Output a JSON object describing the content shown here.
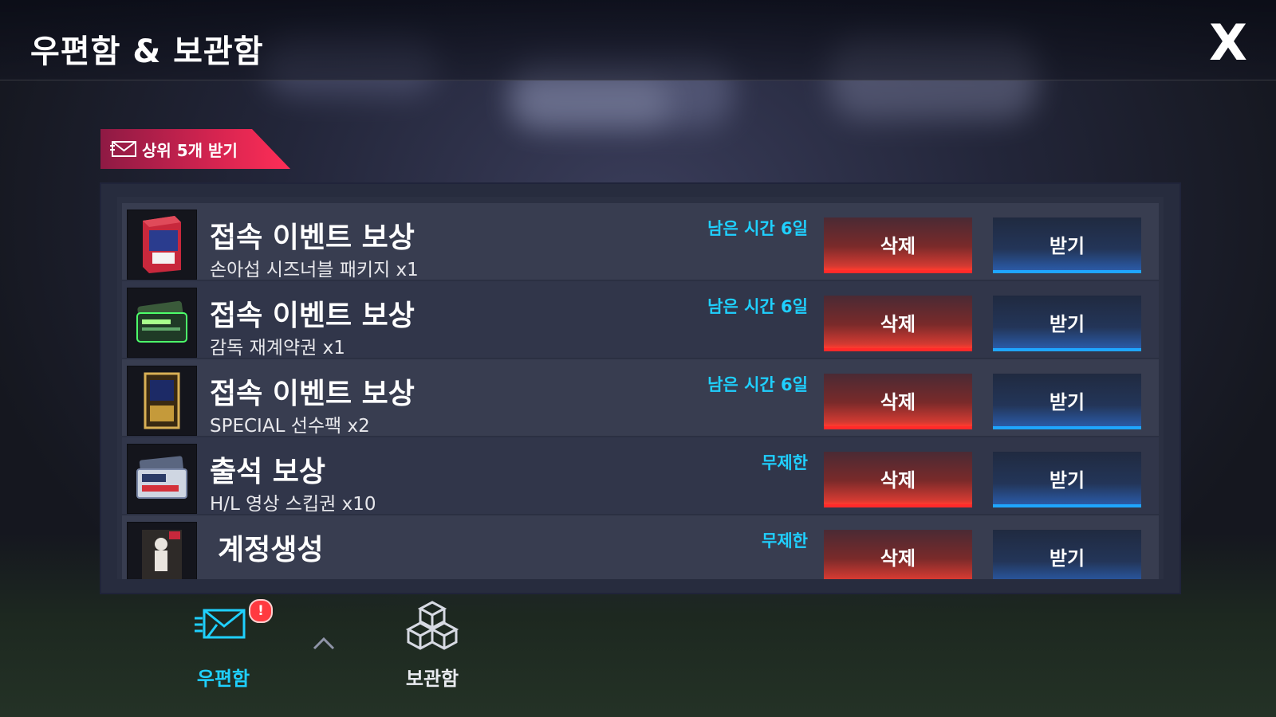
{
  "header": {
    "title": "우편함 & 보관함",
    "close_label": "X"
  },
  "claim_top": {
    "label": "상위 5개 받기"
  },
  "items": [
    {
      "title": "접속 이벤트 보상",
      "subtitle": "손아섭 시즈너블 패키지 x1",
      "remaining": "남은 시간 6일",
      "delete_label": "삭제",
      "claim_label": "받기",
      "thumb_icon": "package-icon"
    },
    {
      "title": "접속 이벤트 보상",
      "subtitle": "감독 재계약권 x1",
      "remaining": "남은 시간 6일",
      "delete_label": "삭제",
      "claim_label": "받기",
      "thumb_icon": "ticket-icon"
    },
    {
      "title": "접속 이벤트 보상",
      "subtitle": "SPECIAL 선수팩 x2",
      "remaining": "남은 시간 6일",
      "delete_label": "삭제",
      "claim_label": "받기",
      "thumb_icon": "card-pack-icon"
    },
    {
      "title": "출석 보상",
      "subtitle": "H/L 영상 스킵권 x10",
      "remaining": "무제한",
      "delete_label": "삭제",
      "claim_label": "받기",
      "thumb_icon": "skip-ticket-icon"
    },
    {
      "title": "계정생성",
      "subtitle": "",
      "remaining": "무제한",
      "delete_label": "삭제",
      "claim_label": "받기",
      "thumb_icon": "player-card-icon"
    }
  ],
  "tabs": {
    "mail": {
      "label": "우편함",
      "badge": "!"
    },
    "storage": {
      "label": "보관함"
    }
  },
  "colors": {
    "accent_cyan": "#1fd0ff",
    "delete_red": "#ff2a2a",
    "claim_blue": "#1fa6ff",
    "claim_top_pink": "#ff2e57"
  }
}
